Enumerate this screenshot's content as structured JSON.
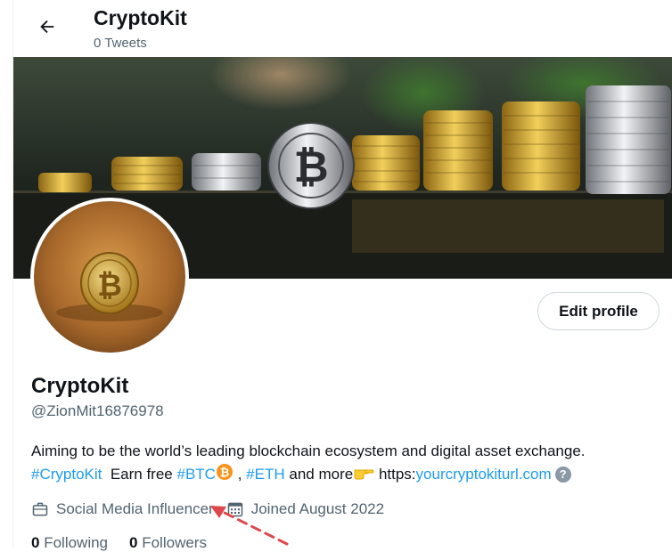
{
  "header": {
    "title": "CryptoKit",
    "subtitle": "0 Tweets"
  },
  "profile": {
    "display_name": "CryptoKit",
    "handle": "@ZionMit16876978",
    "edit_button": "Edit profile",
    "bio": {
      "line1": "Aiming to be the world’s leading blockchain ecosystem and digital asset exchange.",
      "hashtag_cryptokit": "#CryptoKit",
      "earn_free": "Earn free",
      "hashtag_btc": "#BTC",
      "comma": ",",
      "hashtag_eth": "#ETH",
      "and_more": "and more",
      "link_prefix": "https:",
      "link_text": "yourcryptokiturl.com",
      "help_mark": "?"
    },
    "category": "Social Media Influencer",
    "joined": "Joined August 2022",
    "following_count": "0",
    "following_label": "Following",
    "followers_count": "0",
    "followers_label": "Followers"
  },
  "colors": {
    "accent": "#1d9bf0",
    "muted": "#536471",
    "annotation_arrow": "#e0474c"
  },
  "icons": [
    "back-arrow-icon",
    "briefcase-icon",
    "calendar-icon",
    "bitcoin-emoji",
    "pointing-hand-emoji",
    "help-icon"
  ]
}
